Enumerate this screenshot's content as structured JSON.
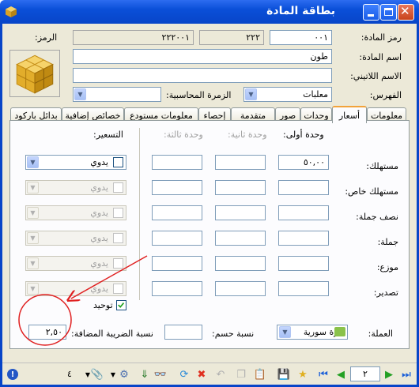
{
  "window": {
    "title": "بطاقة المادة"
  },
  "header": {
    "code_label": "رمز المادة:",
    "code_value": "٠٠١",
    "code_part2": "٢٢٢",
    "code_part3": "٢٢٢٠٠١",
    "symbol_label": "الرمز:",
    "name_label": "اسم المادة:",
    "name_value": "طون",
    "latin_label": "الاسم اللاتيني:",
    "latin_value": "",
    "index_label": "الفهرس:",
    "index_value": "معلبات",
    "acc_group_label": "الزمرة المحاسبية:",
    "acc_group_value": ""
  },
  "tabs": [
    {
      "label": "معلومات"
    },
    {
      "label": "أسعار"
    },
    {
      "label": "وحدات"
    },
    {
      "label": "صور"
    },
    {
      "label": "متقدمة"
    },
    {
      "label": "إحصاء"
    },
    {
      "label": "معلومات مستودع"
    },
    {
      "label": "خصائص إضافية"
    },
    {
      "label": "بدائل باركود"
    }
  ],
  "prices": {
    "unit1_label": "وحدة أولى:",
    "unit2_label": "وحدة ثانية:",
    "unit3_label": "وحدة ثالثة:",
    "pricing_label": "التسعير:",
    "rows": [
      {
        "label": "مستهلك:",
        "unit1": "٥٠,٠٠",
        "pricing": "يدوي"
      },
      {
        "label": "مستهلك خاص:",
        "unit1": "",
        "pricing": "يدوي"
      },
      {
        "label": "نصف جملة:",
        "unit1": "",
        "pricing": "يدوي"
      },
      {
        "label": "جملة:",
        "unit1": "",
        "pricing": "يدوي"
      },
      {
        "label": "موزع:",
        "unit1": "",
        "pricing": "يدوي"
      },
      {
        "label": "تصدير:",
        "unit1": "",
        "pricing": "يدوي"
      }
    ],
    "unify_label": "توحيد"
  },
  "footer": {
    "currency_label": "العملة:",
    "currency_value": "ليرة سورية",
    "discount_label": "نسبة حسم:",
    "discount_value": "",
    "vat_label": "نسبة الضريبة المضافة:",
    "vat_value": "٢,٥٠"
  },
  "toolbar": {
    "page_value": "٢",
    "count_value": "٤"
  },
  "colors": {
    "titlebar": "#0a4fd8",
    "frame": "#ece9d8",
    "annotation": "#e02020"
  }
}
